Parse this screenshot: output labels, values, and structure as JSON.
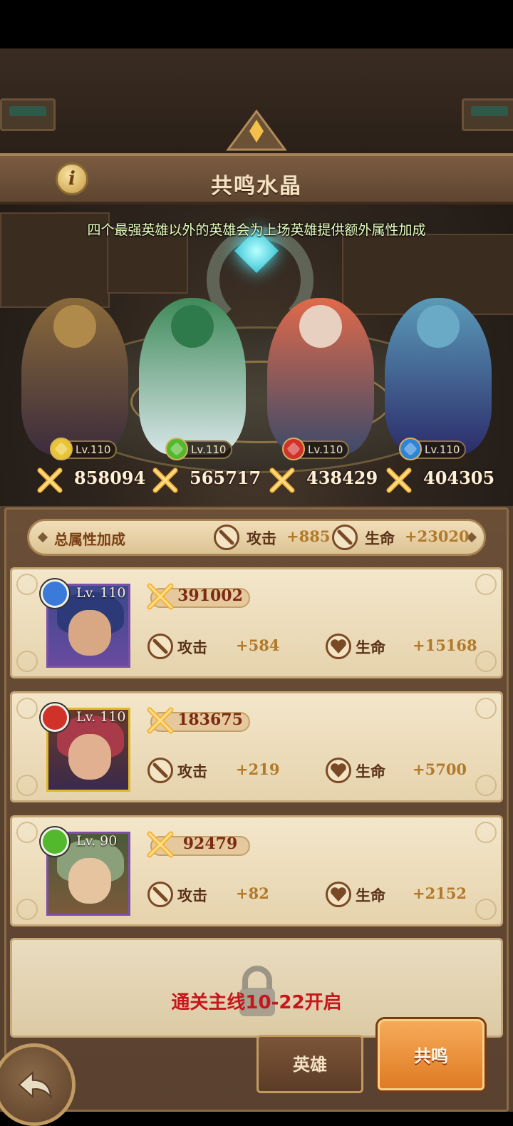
{
  "header": {
    "title": "共鸣水晶",
    "subtitle": "四个最强英雄以外的英雄会为上场英雄提供额外属性加成"
  },
  "top_heroes": [
    {
      "level": "Lv.110",
      "power": "858094",
      "gem_color": "#e8c531"
    },
    {
      "level": "Lv.110",
      "power": "565717",
      "gem_color": "#52b82c"
    },
    {
      "level": "Lv.110",
      "power": "438429",
      "gem_color": "#d0322a"
    },
    {
      "level": "Lv.110",
      "power": "404305",
      "gem_color": "#2e84d8"
    }
  ],
  "total_bonus": {
    "label": "总属性加成",
    "attack_label": "攻击",
    "attack_value": "+885",
    "hp_label": "生命",
    "hp_value": "+23020"
  },
  "support_heroes": [
    {
      "level": "Lv. 110",
      "power": "391002",
      "attack_label": "攻击",
      "attack": "+584",
      "hp_label": "生命",
      "hp": "+15168",
      "gem_color": "#3a7ad8",
      "frame_color": "#7c4fa8"
    },
    {
      "level": "Lv. 110",
      "power": "183675",
      "attack_label": "攻击",
      "attack": "+219",
      "hp_label": "生命",
      "hp": "+5700",
      "gem_color": "#d0322a",
      "frame_color": "#e0b82a"
    },
    {
      "level": "Lv. 90",
      "power": "92479",
      "attack_label": "攻击",
      "attack": "+82",
      "hp_label": "生命",
      "hp": "+2152",
      "gem_color": "#52b82c",
      "frame_color": "#7c4fa8"
    }
  ],
  "locked_slot": {
    "text": "通关主线10-22开启"
  },
  "nav": {
    "hero_tab": "英雄",
    "resonance_tab": "共鸣"
  },
  "colors": {
    "accent": "#e07a24",
    "text_brown": "#5a3218",
    "value_gold": "#b07a2a"
  }
}
